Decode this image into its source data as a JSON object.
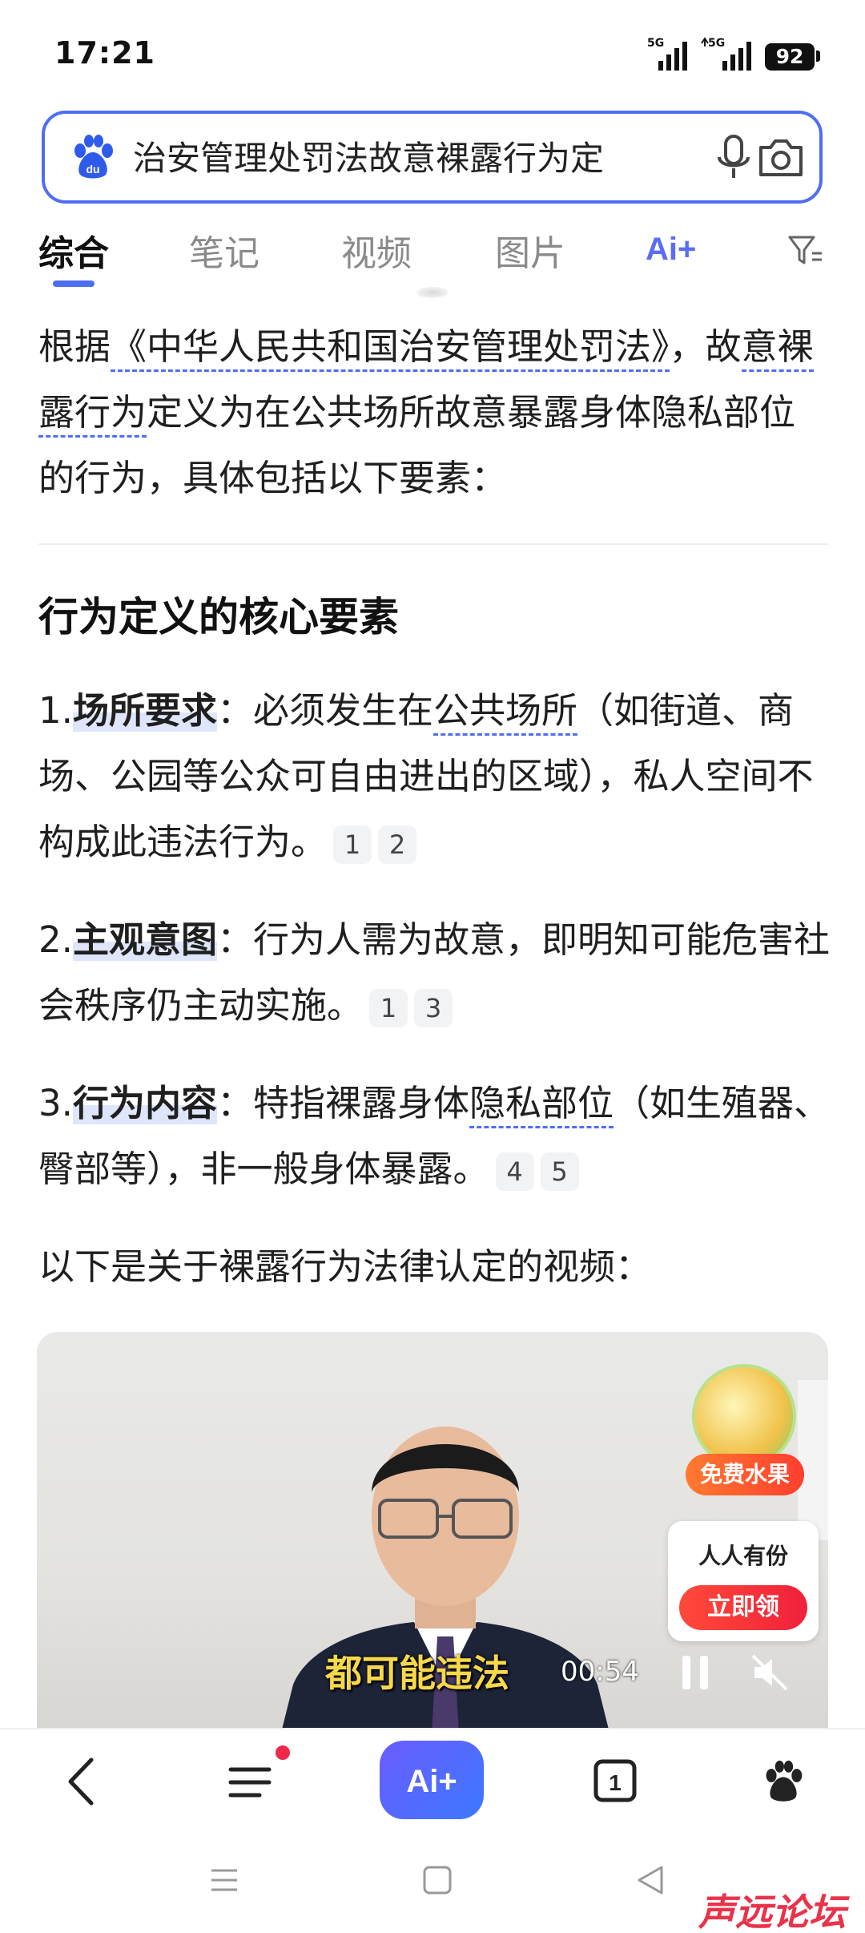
{
  "status_bar": {
    "time": "17:21",
    "signal_1": "5G",
    "signal_2": "5G",
    "battery": "92"
  },
  "search": {
    "query": "治安管理处罚法故意裸露行为定",
    "logo_text": "du",
    "accent_color": "#4e6ef2"
  },
  "tabs": [
    {
      "label": "综合",
      "active": true
    },
    {
      "label": "笔记",
      "active": false
    },
    {
      "label": "视频",
      "active": false
    },
    {
      "label": "图片",
      "active": false
    }
  ],
  "ai_tab_label": "Ai+",
  "intro": {
    "part1": "根据",
    "law_link": "《中华人民共和国治安管理处罚法》",
    "part2": "，故",
    "term_link": "意裸露行为",
    "part3": "定义为在公共场所故意暴露身体隐私部位的行为，具体包括以下要素："
  },
  "section_heading": "行为定义的核心要素",
  "items": [
    {
      "num": "1.",
      "keyword": "场所要求",
      "colon": "：",
      "text_a": "必须发生在",
      "link": "公共场所",
      "text_b": "（如街道、商场、公园等公众可自由进出的区域），私人空间不构成此违法行为。",
      "refs": [
        "1",
        "2"
      ]
    },
    {
      "num": "2.",
      "keyword": "主观意图",
      "colon": "：",
      "text_a": "行为人需为故意，即明知可能危害社会秩序仍主动实施。",
      "link": "",
      "text_b": "",
      "refs": [
        "1",
        "3"
      ]
    },
    {
      "num": "3.",
      "keyword": "行为内容",
      "colon": "：",
      "text_a": "特指裸露身体",
      "link": "隐私部位",
      "text_b": "（如生殖器、臀部等），非一般身体暴露。",
      "refs": [
        "4",
        "5"
      ]
    }
  ],
  "video_intro": "以下是关于裸露行为法律认定的视频：",
  "video": {
    "subtitle": "都可能违法",
    "duration": "00:54",
    "fruit_badge": "免费水果",
    "promo_text": "人人有份",
    "promo_button": "立即领"
  },
  "toolbar": {
    "tab_count": "1",
    "ai_label": "Ai+"
  },
  "watermark": "声远论坛"
}
